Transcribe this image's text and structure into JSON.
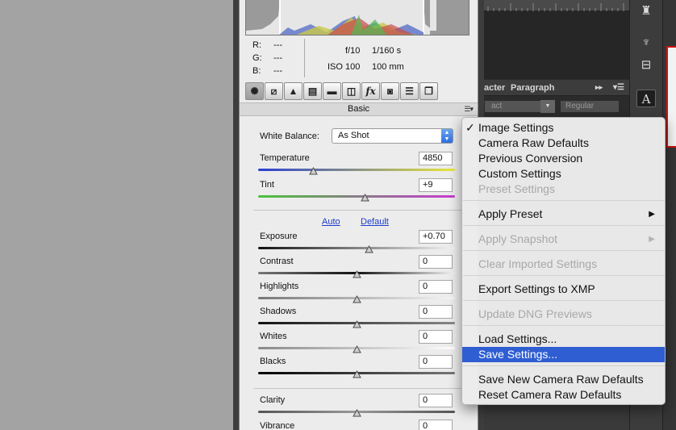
{
  "histogram_info": {
    "r_label": "R:",
    "g_label": "G:",
    "b_label": "B:",
    "r_value": "---",
    "g_value": "---",
    "b_value": "---",
    "aperture": "f/10",
    "shutter": "1/160 s",
    "iso": "ISO 100",
    "focal_length": "100 mm"
  },
  "toolbar": {
    "fx_label": "fx"
  },
  "section": {
    "title": "Basic",
    "menu_icon": "menu-icon"
  },
  "white_balance": {
    "label": "White Balance:",
    "value": "As Shot"
  },
  "sliders": {
    "temperature": {
      "label": "Temperature",
      "value": "4850",
      "position": 0.28
    },
    "tint": {
      "label": "Tint",
      "value": "+9",
      "position": 0.54
    },
    "exposure": {
      "label": "Exposure",
      "value": "+0.70",
      "position": 0.56
    },
    "contrast": {
      "label": "Contrast",
      "value": "0",
      "position": 0.5
    },
    "highlights": {
      "label": "Highlights",
      "value": "0",
      "position": 0.5
    },
    "shadows": {
      "label": "Shadows",
      "value": "0",
      "position": 0.5
    },
    "whites": {
      "label": "Whites",
      "value": "0",
      "position": 0.5
    },
    "blacks": {
      "label": "Blacks",
      "value": "0",
      "position": 0.5
    },
    "clarity": {
      "label": "Clarity",
      "value": "0",
      "position": 0.5
    },
    "vibrance": {
      "label": "Vibrance",
      "value": "0",
      "position": 0.5
    }
  },
  "links": {
    "auto": "Auto",
    "default": "Default"
  },
  "photoshop": {
    "tab_character": "acter",
    "tab_paragraph": "Paragraph",
    "font_field": "act",
    "style_field": "Regular",
    "type_tool": "A",
    "panel_scroll_arrows": "▸▸"
  },
  "context_menu": {
    "items": [
      {
        "label": "Image Settings",
        "checked": true,
        "enabled": true
      },
      {
        "label": "Camera Raw Defaults",
        "enabled": true
      },
      {
        "label": "Previous Conversion",
        "enabled": true
      },
      {
        "label": "Custom Settings",
        "enabled": true
      },
      {
        "label": "Preset Settings",
        "enabled": false
      },
      {
        "label": "Apply Preset",
        "enabled": true,
        "submenu": true
      },
      {
        "label": "Apply Snapshot",
        "enabled": false,
        "submenu": true
      },
      {
        "label": "Clear Imported Settings",
        "enabled": false
      },
      {
        "label": "Export Settings to XMP",
        "enabled": true
      },
      {
        "label": "Update DNG Previews",
        "enabled": false
      },
      {
        "label": "Load Settings...",
        "enabled": true
      },
      {
        "label": "Save Settings...",
        "enabled": true,
        "selected": true
      },
      {
        "label": "Save New Camera Raw Defaults",
        "enabled": true
      },
      {
        "label": "Reset Camera Raw Defaults",
        "enabled": true
      }
    ],
    "check_glyph": "✓",
    "submenu_glyph": "▶"
  },
  "colors": {
    "menu_highlight": "#2f5ed2",
    "link": "#1d3ccc",
    "selection_border": "#cc1111"
  }
}
